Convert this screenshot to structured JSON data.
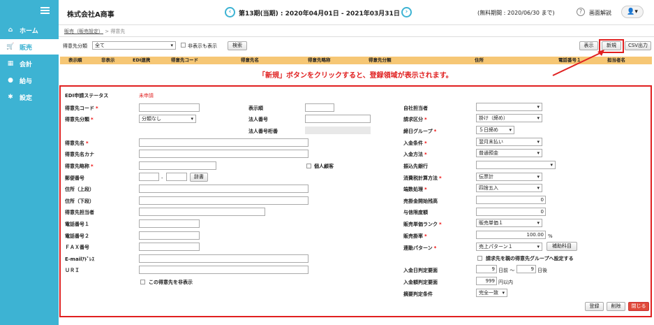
{
  "app": {
    "company": "株式会社A商事",
    "period": "第13期(当期) : 2020年04月01日 - 2021年03月31日",
    "free_period": "(無料期間 : 2020/06/30 まで)",
    "help": "画面解説"
  },
  "sidebar": {
    "items": [
      {
        "label": "ホーム",
        "icon": "home-icon"
      },
      {
        "label": "販売",
        "icon": "cart-icon"
      },
      {
        "label": "会計",
        "icon": "calc-icon"
      },
      {
        "label": "給与",
        "icon": "money-bag-icon"
      },
      {
        "label": "設定",
        "icon": "gear-icon"
      }
    ]
  },
  "breadcrumb": {
    "parent": "販売（販売設定）",
    "sep": ">",
    "current": "得意先"
  },
  "filter": {
    "label": "得意先分類",
    "value": "全て",
    "hidden_label": "非表示も表示",
    "search": "検索",
    "show": "表示",
    "new": "新規",
    "csv": "CSV出力"
  },
  "table": {
    "headers": [
      "表示順",
      "非表示",
      "EDI連携",
      "得意先コード",
      "得意先名",
      "得意先略称",
      "得意先分類",
      "住所",
      "電話番号１",
      "担当者名"
    ]
  },
  "annotation": "「新規」ボタンをクリックすると、登録領域が表示されます。",
  "form": {
    "edi_status_label": "EDI申請ステータス",
    "edi_status_value": "未申請",
    "left": [
      {
        "label": "得意先コード",
        "req": "*"
      },
      {
        "label": "得意先分類",
        "req": "*",
        "value": "分類なし"
      },
      {
        "label": "得意先名",
        "req": "*"
      },
      {
        "label": "得意先名カナ",
        "req": ""
      },
      {
        "label": "得意先略称",
        "req": "*"
      },
      {
        "label": "郵便番号",
        "req": ""
      },
      {
        "label": "住所（上段）",
        "req": ""
      },
      {
        "label": "住所（下段）",
        "req": ""
      },
      {
        "label": "得意先担当者",
        "req": ""
      },
      {
        "label": "電話番号１",
        "req": ""
      },
      {
        "label": "電話番号２",
        "req": ""
      },
      {
        "label": "ＦＡＸ番号",
        "req": ""
      },
      {
        "label": "E-mailｱﾄﾞﾚｽ",
        "req": ""
      },
      {
        "label": "ＵＲＩ",
        "req": ""
      }
    ],
    "zip_sep": "-",
    "dict": "辞書",
    "hide_this": "この得意先を非表示",
    "mid": {
      "order": "表示順",
      "corp_no": "法人番号",
      "corp_no_check": "法人番号桁番",
      "individual": "個人顧客"
    },
    "right": [
      {
        "label": "自社担当者",
        "req": "",
        "value": ""
      },
      {
        "label": "請求区分",
        "req": "*",
        "value": "掛け（締め）"
      },
      {
        "label": "締日グループ",
        "req": "*",
        "value": "５日締め"
      },
      {
        "label": "入金条件",
        "req": "*",
        "value": "翌月末払い"
      },
      {
        "label": "入金方法",
        "req": "*",
        "value": "普通預金"
      },
      {
        "label": "振込先銀行",
        "req": "",
        "value": ""
      },
      {
        "label": "消費税計算方法",
        "req": "*",
        "value": "伝票計"
      },
      {
        "label": "端数処理",
        "req": "*",
        "value": "四捨五入"
      },
      {
        "label": "売掛金開始残高",
        "req": "",
        "value": "0"
      },
      {
        "label": "与信限度額",
        "req": "",
        "value": "0"
      },
      {
        "label": "販売単価ランク",
        "req": "*",
        "value": "販売単価１"
      },
      {
        "label": "販売掛率",
        "req": "*",
        "value": "100.00"
      },
      {
        "label": "連動パターン",
        "req": "*",
        "value": "売上パターン１"
      }
    ],
    "percent": "%",
    "sub_account": "補助科目",
    "group_check": "請求先を親の得意先グループへ設定する",
    "deposit_date_label": "入金日判定要面",
    "deposit_from": "9",
    "deposit_from_unit": "日前 〜",
    "deposit_to": "9",
    "deposit_to_unit": "日後",
    "deposit_amt_label": "入金額判定要面",
    "deposit_amt": "999",
    "deposit_amt_unit": "円以内",
    "summary_label": "摘要判定条件",
    "summary_value": "完全一致",
    "register": "登録",
    "delete": "削除",
    "close": "閉じる"
  },
  "colors": {
    "sidebar": "#3db3d3",
    "accent_red": "#e02020",
    "header_row": "#f6c775",
    "close_btn": "#e04a3a"
  }
}
